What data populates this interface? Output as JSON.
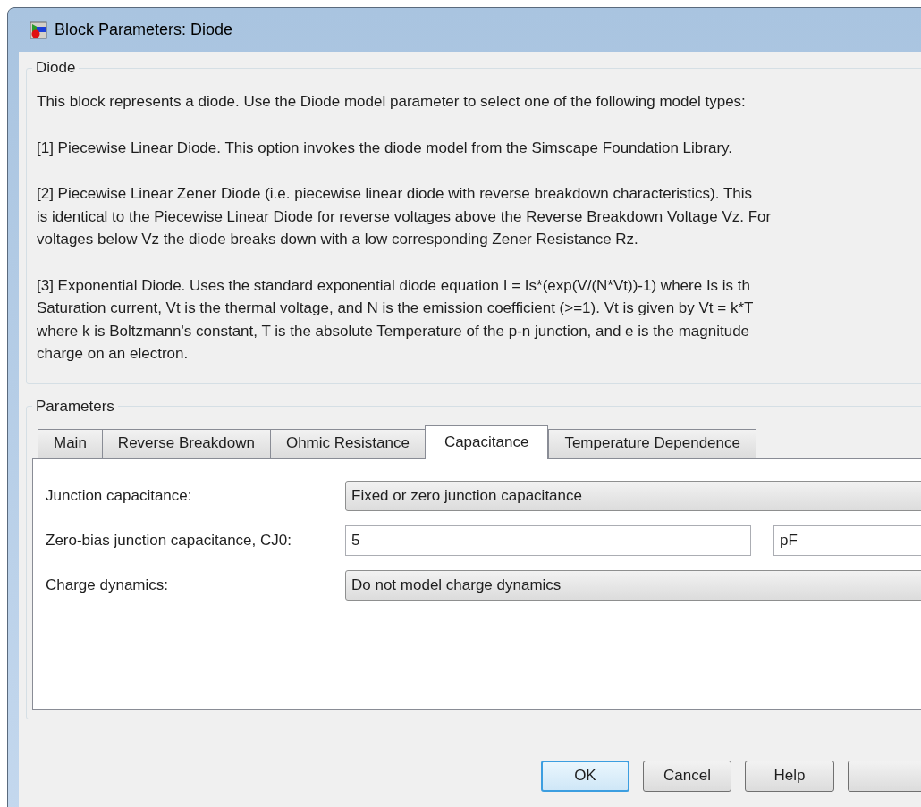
{
  "window": {
    "title": "Block Parameters: Diode"
  },
  "description": {
    "heading": "Diode",
    "paragraphs": [
      {
        "lines": [
          "This block represents a diode. Use the Diode model parameter to select one of the following model types:"
        ]
      },
      {
        "lines": [
          "[1] Piecewise Linear Diode. This option invokes the diode model from the Simscape Foundation Library."
        ]
      },
      {
        "lines": [
          "[2] Piecewise Linear Zener Diode (i.e. piecewise linear diode with reverse breakdown characteristics). This",
          "is identical to the Piecewise Linear Diode for reverse voltages above the Reverse Breakdown Voltage Vz. For",
          "voltages below Vz the diode breaks down with a low corresponding Zener Resistance Rz."
        ]
      },
      {
        "lines": [
          "[3] Exponential Diode. Uses the standard exponential diode equation I = Is*(exp(V/(N*Vt))-1) where Is is th",
          "Saturation current, Vt is the thermal voltage, and N is the emission coefficient (>=1). Vt is given by Vt = k*T",
          "where k is Boltzmann's constant, T is the absolute Temperature of the p-n junction, and e is the magnitude",
          "charge on an electron."
        ]
      }
    ]
  },
  "parameters": {
    "heading": "Parameters",
    "tabs": [
      {
        "label": "Main",
        "selected": false
      },
      {
        "label": "Reverse Breakdown",
        "selected": false
      },
      {
        "label": "Ohmic Resistance",
        "selected": false
      },
      {
        "label": "Capacitance",
        "selected": true
      },
      {
        "label": "Temperature Dependence",
        "selected": false
      }
    ],
    "fields": [
      {
        "kind": "dropdown",
        "label": "Junction capacitance:",
        "value": "Fixed or zero junction capacitance"
      },
      {
        "kind": "number",
        "label": "Zero-bias junction capacitance, CJ0:",
        "value": "5",
        "unit": "pF"
      },
      {
        "kind": "dropdown",
        "label": "Charge dynamics:",
        "value": "Do not model charge dynamics"
      }
    ]
  },
  "buttons": [
    {
      "label": "OK",
      "default": true
    },
    {
      "label": "Cancel",
      "default": false
    },
    {
      "label": "Help",
      "default": false
    }
  ]
}
